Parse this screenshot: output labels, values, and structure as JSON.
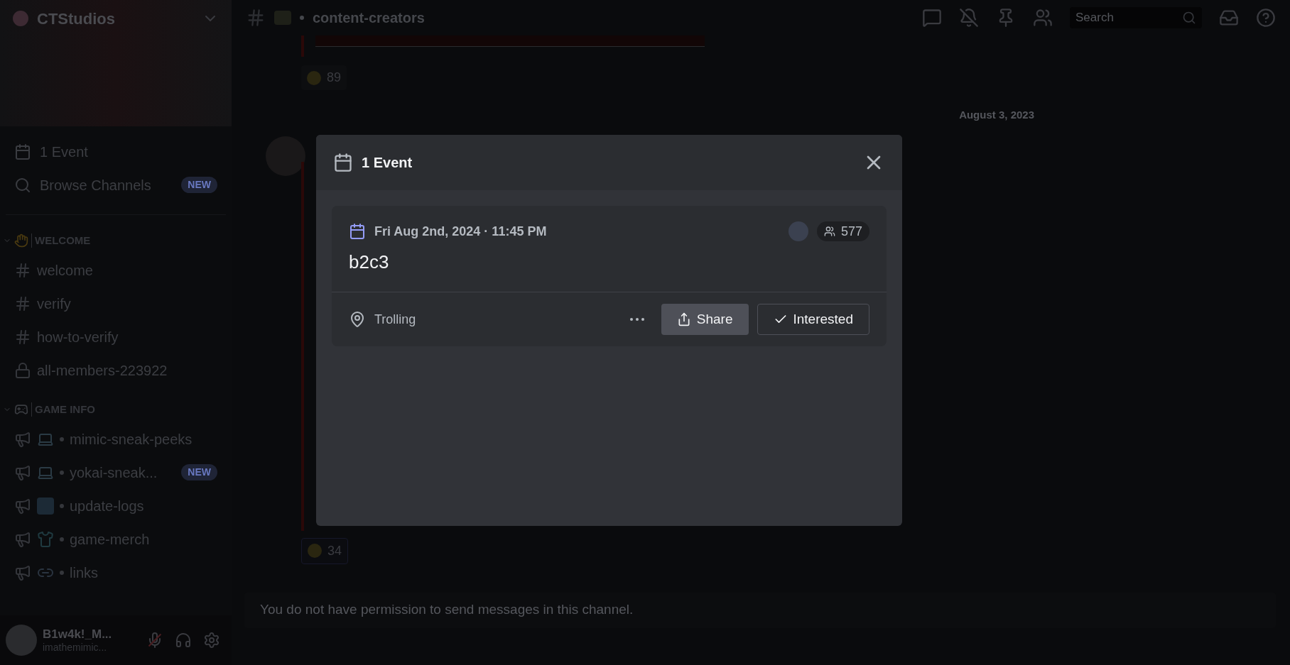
{
  "server": {
    "name": "CTStudios"
  },
  "sidebar_top": [
    {
      "kind": "event",
      "label": "1 Event"
    },
    {
      "kind": "browse",
      "label": "Browse Channels",
      "badge": "NEW"
    }
  ],
  "categories": [
    {
      "kind": "wave",
      "name": "WELCOME",
      "expanded": true,
      "channels": [
        {
          "kind": "text",
          "name": "welcome"
        },
        {
          "kind": "text",
          "name": "verify"
        },
        {
          "kind": "text",
          "name": "how-to-verify"
        },
        {
          "kind": "locked",
          "name": "all-members-223922"
        }
      ]
    },
    {
      "kind": "gamepad",
      "name": "GAME INFO",
      "expanded": true,
      "channels": [
        {
          "kind": "laptop",
          "name": "mimic-sneak-peeks"
        },
        {
          "kind": "laptop",
          "name": "yokai-sneak...",
          "badge": "NEW"
        },
        {
          "kind": "new",
          "name": "update-logs"
        },
        {
          "kind": "shirt",
          "name": "game-merch"
        },
        {
          "kind": "link",
          "name": "links"
        }
      ]
    }
  ],
  "user": {
    "name": "B1w4k!_M...",
    "handle": "imathemimic...",
    "muted": true
  },
  "channel_header": {
    "name": "content-creators",
    "search": {
      "placeholder": "Search"
    }
  },
  "chat": {
    "reaction_1": {
      "count": "89"
    },
    "date_divider": "August 3, 2023",
    "reaction_2": {
      "count": "34"
    },
    "notice": "You do not have permission to send messages in this channel."
  },
  "modal": {
    "title": "1 Event",
    "event": {
      "datetime": "Fri Aug 2nd, 2024 · 11:45 PM",
      "interested_count": "577",
      "title": "b2c3",
      "location": "Trolling",
      "share_label": "Share",
      "interested_label": "Interested"
    }
  }
}
